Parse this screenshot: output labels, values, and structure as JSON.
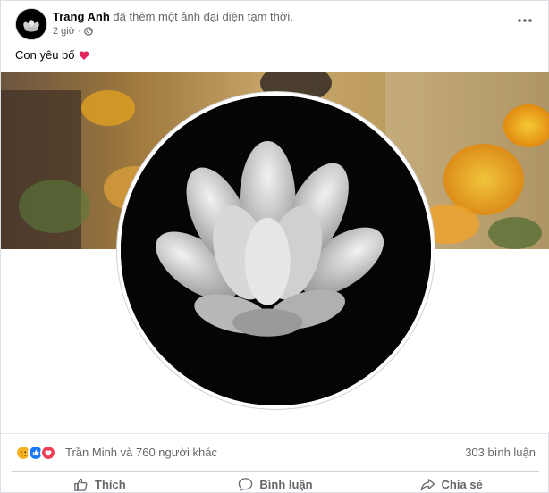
{
  "post": {
    "author": "Trang Anh",
    "action": "đã thêm một ảnh đại diện tạm thời.",
    "time": "2 giờ",
    "separator": "·",
    "caption": "Con yêu bố",
    "more_icon": "more-horizontal-icon",
    "privacy_icon": "globe-icon"
  },
  "reactions": {
    "icons": [
      "sad-reaction-icon",
      "like-reaction-icon",
      "love-reaction-icon"
    ],
    "summary": "Trần Minh và 760 người khác",
    "comments": "303 bình luận"
  },
  "actions": [
    {
      "label": "Thích",
      "icon": "thumbs-up-icon"
    },
    {
      "label": "Bình luận",
      "icon": "comment-icon"
    },
    {
      "label": "Chia sẻ",
      "icon": "share-icon"
    }
  ],
  "colors": {
    "secondary_text": "#65676b",
    "like_blue": "#1877f2",
    "love_red": "#f33e58",
    "sad_yellow": "#f7b125",
    "heart_red": "#e0245e"
  }
}
